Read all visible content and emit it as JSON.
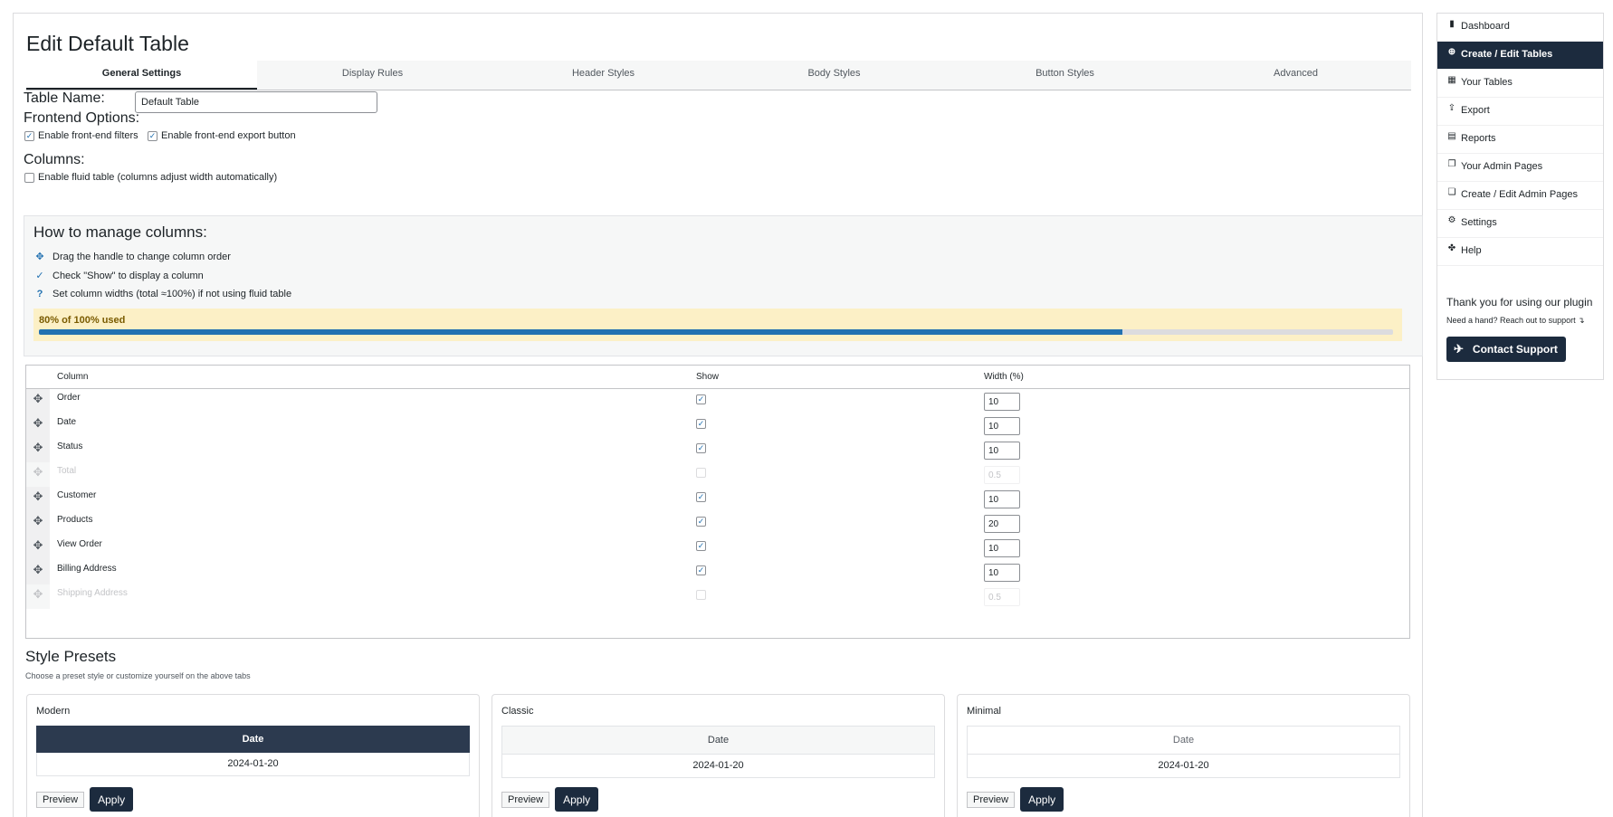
{
  "page": {
    "title": "Edit Default Table"
  },
  "tabs": [
    {
      "label": "General Settings",
      "active": true
    },
    {
      "label": "Display Rules"
    },
    {
      "label": "Header Styles"
    },
    {
      "label": "Body Styles"
    },
    {
      "label": "Button Styles"
    },
    {
      "label": "Advanced"
    }
  ],
  "general": {
    "table_name_label": "Table Name:",
    "table_name_value": "Default Table",
    "frontend_options_label": "Frontend Options:",
    "enable_filters_label": "Enable front-end filters",
    "enable_export_label": "Enable front-end export button",
    "columns_label": "Columns:",
    "fluid_table_label": "Enable fluid table (columns adjust width automatically)"
  },
  "howto": {
    "title": "How to manage columns:",
    "items": [
      {
        "icon": "move-icon",
        "text": "Drag the handle to change column order"
      },
      {
        "icon": "check-icon",
        "text": "Check \"Show\" to display a column"
      },
      {
        "icon": "help-icon",
        "text": "Set column widths (total ≈100%) if not using fluid table"
      }
    ]
  },
  "usage": {
    "text": "80% of 100% used",
    "percent": 80
  },
  "columns_table": {
    "headers": {
      "column": "Column",
      "show": "Show",
      "width": "Width (%)"
    },
    "rows": [
      {
        "name": "Order",
        "show": true,
        "width": "10"
      },
      {
        "name": "Date",
        "show": true,
        "width": "10"
      },
      {
        "name": "Status",
        "show": true,
        "width": "10"
      },
      {
        "name": "Total",
        "show": false,
        "width": "0.5"
      },
      {
        "name": "Customer",
        "show": true,
        "width": "10"
      },
      {
        "name": "Products",
        "show": true,
        "width": "20"
      },
      {
        "name": "View Order",
        "show": true,
        "width": "10"
      },
      {
        "name": "Billing Address",
        "show": true,
        "width": "10"
      },
      {
        "name": "Shipping Address",
        "show": false,
        "width": "0.5"
      }
    ]
  },
  "presets": {
    "title": "Style Presets",
    "subtitle": "Choose a preset style or customize yourself on the above tabs",
    "preview_label": "Preview",
    "apply_label": "Apply",
    "items": [
      {
        "name": "Modern",
        "header": "Date",
        "cell": "2024-01-20",
        "header_bg": "#2c3a4f",
        "header_color": "#ffffff"
      },
      {
        "name": "Classic",
        "header": "Date",
        "cell": "2024-01-20",
        "header_bg": "#f6f7f7",
        "header_color": "#3c434a"
      },
      {
        "name": "Minimal",
        "header": "Date",
        "cell": "2024-01-20",
        "header_bg": "#ffffff",
        "header_color": "#646970"
      }
    ]
  },
  "sidebar": {
    "items": [
      {
        "label": "Dashboard",
        "icon": "bar-chart-icon"
      },
      {
        "label": "Create / Edit Tables",
        "icon": "plus-circle-icon",
        "active": true
      },
      {
        "label": "Your Tables",
        "icon": "table-icon"
      },
      {
        "label": "Export",
        "icon": "export-icon"
      },
      {
        "label": "Reports",
        "icon": "report-icon"
      },
      {
        "label": "Your Admin Pages",
        "icon": "pages-icon"
      },
      {
        "label": "Create / Edit Admin Pages",
        "icon": "edit-pages-icon"
      },
      {
        "label": "Settings",
        "icon": "gear-icon"
      },
      {
        "label": "Help",
        "icon": "lifebuoy-icon"
      }
    ],
    "thanks": "Thank you for using our plugin",
    "need_hand": "Need a hand? Reach out to support ↴",
    "contact_label": "Contact Support"
  },
  "colors": {
    "accent": "#1c2b3e",
    "link": "#2271b1",
    "usage_bg": "#fcf0c6"
  }
}
